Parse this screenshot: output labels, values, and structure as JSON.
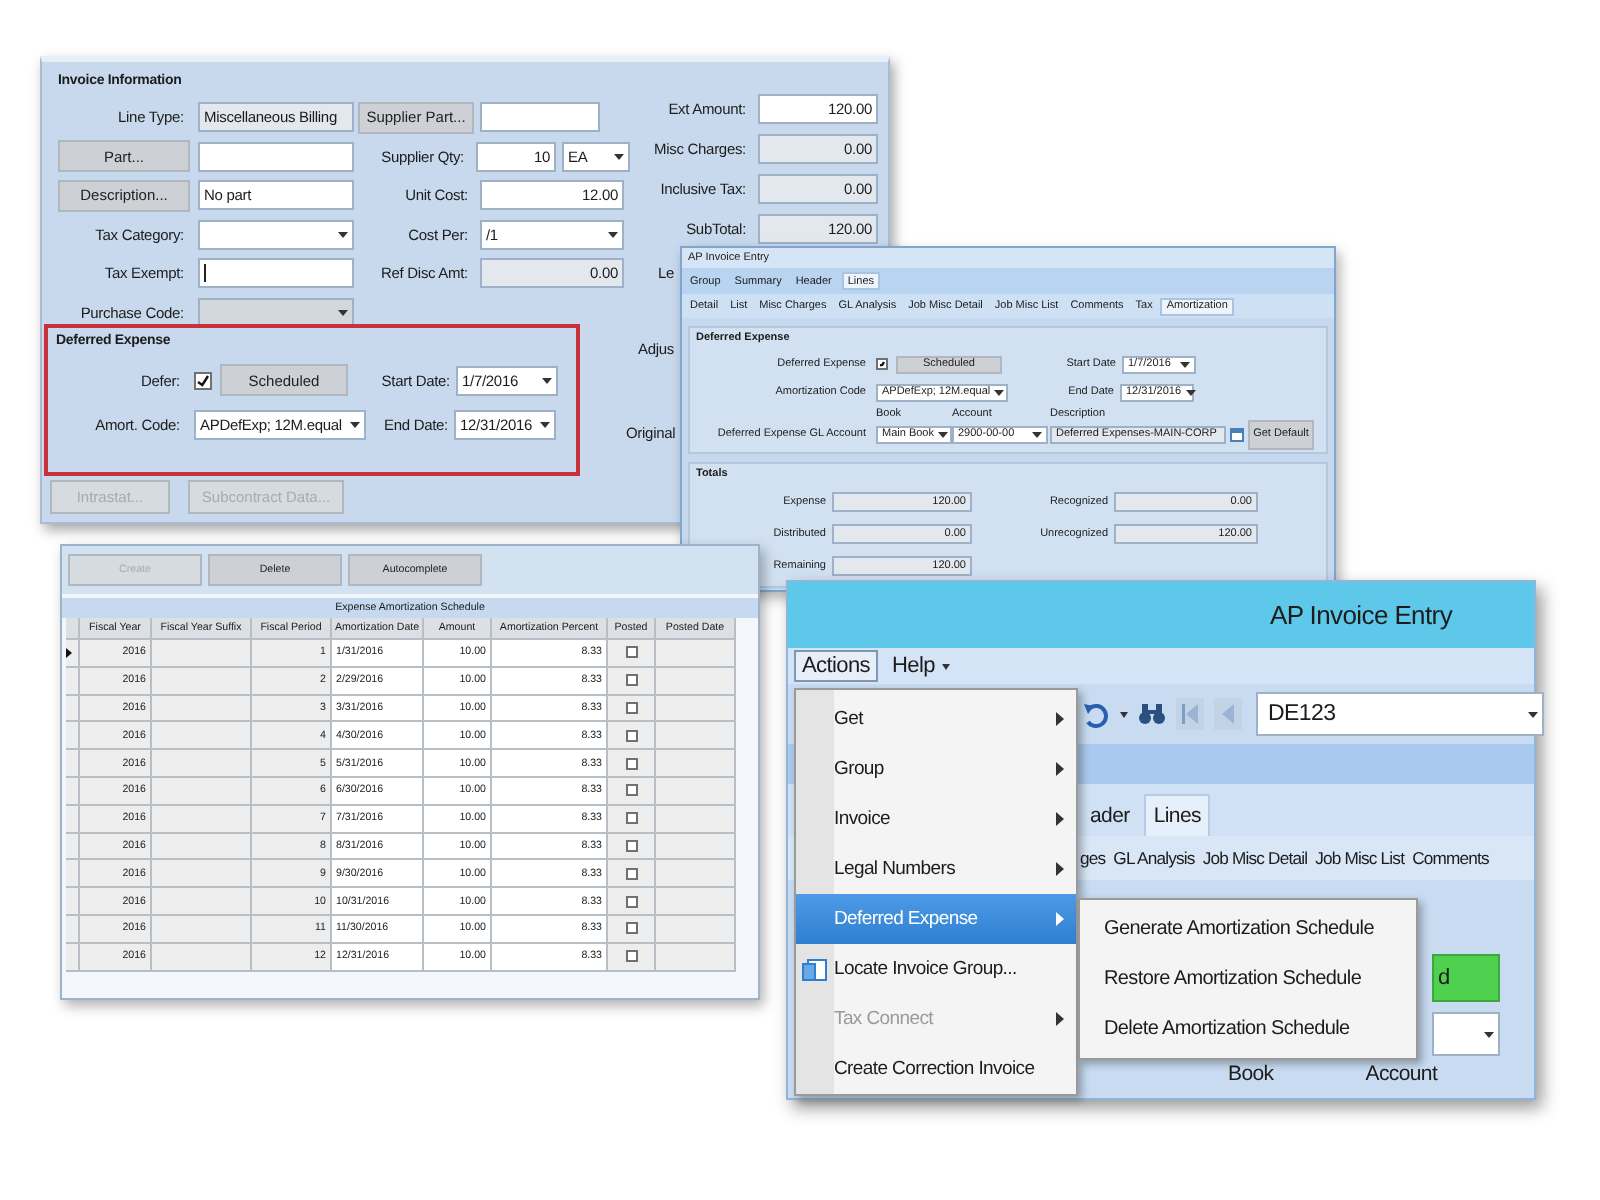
{
  "invoice_panel": {
    "title": "Invoice Information",
    "left_rows": [
      {
        "kind": "readonly",
        "label": "Line Type:",
        "value": "Miscellaneous Billing"
      },
      {
        "kind": "button",
        "button": "Part..."
      },
      {
        "kind": "button",
        "button": "Description...",
        "value": "No part"
      },
      {
        "kind": "combo",
        "label": "Tax Category:",
        "disabled": false
      },
      {
        "kind": "text",
        "label": "Tax Exempt:"
      },
      {
        "kind": "combo",
        "label": "Purchase Code:",
        "disabled": true
      }
    ],
    "middle_rows": [
      {
        "kind": "button",
        "button": "Supplier Part..."
      },
      {
        "kind": "qty",
        "label": "Supplier Qty:",
        "value": "10",
        "unit": "EA"
      },
      {
        "kind": "text",
        "label": "Unit Cost:",
        "value": "12.00"
      },
      {
        "kind": "combo",
        "label": "Cost Per:",
        "value": "/1",
        "disabled": false
      },
      {
        "kind": "readonly",
        "label": "Ref Disc Amt:",
        "value": "0.00"
      }
    ],
    "right_rows": [
      {
        "kind": "text",
        "label": "Ext Amount:",
        "value": "120.00"
      },
      {
        "kind": "readonly",
        "label": "Misc Charges:",
        "value": "0.00"
      },
      {
        "kind": "readonly",
        "label": "Inclusive Tax:",
        "value": "0.00"
      },
      {
        "kind": "readonly",
        "label": "SubTotal:",
        "value": "120.00"
      },
      {
        "kind": "covered",
        "label": "Le"
      },
      {
        "kind": "covered",
        "label": "Adjus"
      },
      {
        "kind": "covered",
        "label": "Original"
      }
    ],
    "deferred_expense": {
      "title": "Deferred Expense",
      "defer_label": "Defer:",
      "defer_checked": true,
      "schedule_button": "Scheduled",
      "amort_code_label": "Amort. Code:",
      "amort_code": "APDefExp; 12M.equal",
      "start_date_label": "Start Date:",
      "start_date": "1/7/2016",
      "end_date_label": "End Date:",
      "end_date": "12/31/2016"
    },
    "buttons": [
      {
        "label": "Intrastat...",
        "disabled": true
      },
      {
        "label": "Subcontract Data...",
        "disabled": true
      }
    ]
  },
  "mini_window": {
    "title": "AP Invoice Entry",
    "tabs": [
      {
        "label": "Group",
        "selected": false
      },
      {
        "label": "Summary",
        "selected": false
      },
      {
        "label": "Header",
        "selected": false
      },
      {
        "label": "Lines",
        "selected": true
      }
    ],
    "subtabs": [
      {
        "label": "Detail",
        "selected": false
      },
      {
        "label": "List",
        "selected": false
      },
      {
        "label": "Misc Charges",
        "selected": false
      },
      {
        "label": "GL Analysis",
        "selected": false
      },
      {
        "label": "Job Misc Detail",
        "selected": false
      },
      {
        "label": "Job Misc List",
        "selected": false
      },
      {
        "label": "Comments",
        "selected": false
      },
      {
        "label": "Tax",
        "selected": false
      },
      {
        "label": "Amortization",
        "selected": true
      }
    ],
    "deferred_expense": {
      "title": "Deferred Expense",
      "checkbox_label": "Deferred Expense",
      "checked": true,
      "schedule_button": "Scheduled",
      "amort_code_label": "Amortization Code",
      "amort_code": "APDefExp; 12M.equal",
      "start_date_label": "Start Date",
      "start_date": "1/7/2016",
      "end_date_label": "End Date",
      "end_date": "12/31/2016",
      "gl_account_label": "Deferred Expense GL Account",
      "book_label": "Book",
      "book": "Main Book",
      "account_label": "Account",
      "account": "2900-00-00",
      "description_label": "Description",
      "description": "Deferred Expenses-MAIN-CORP",
      "default_button": "Get Default"
    },
    "totals": {
      "title": "Totals",
      "left": [
        {
          "label": "Expense",
          "value": "120.00"
        },
        {
          "label": "Distributed",
          "value": "0.00"
        },
        {
          "label": "Remaining",
          "value": "120.00"
        }
      ],
      "right": [
        {
          "label": "Recognized",
          "value": "0.00"
        },
        {
          "label": "Unrecognized",
          "value": "120.00"
        }
      ]
    }
  },
  "schedule_panel": {
    "buttons": [
      {
        "label": "Create",
        "disabled": true
      },
      {
        "label": "Delete",
        "disabled": false
      },
      {
        "label": "Autocomplete",
        "disabled": false
      }
    ],
    "grid_title": "Expense Amortization Schedule",
    "columns": [
      "Fiscal Year",
      "Fiscal Year Suffix",
      "Fiscal Period",
      "Amortization Date",
      "Amount",
      "Amortization Percent",
      "Posted",
      "Posted Date"
    ],
    "rows": [
      {
        "selected": true,
        "fiscal_year": "2016",
        "fiscal_period": "1",
        "amortization_date": "1/31/2016",
        "amount": "10.00",
        "amortization_percent": "8.33",
        "posted": false
      },
      {
        "selected": false,
        "fiscal_year": "2016",
        "fiscal_period": "2",
        "amortization_date": "2/29/2016",
        "amount": "10.00",
        "amortization_percent": "8.33",
        "posted": false
      },
      {
        "selected": false,
        "fiscal_year": "2016",
        "fiscal_period": "3",
        "amortization_date": "3/31/2016",
        "amount": "10.00",
        "amortization_percent": "8.33",
        "posted": false
      },
      {
        "selected": false,
        "fiscal_year": "2016",
        "fiscal_period": "4",
        "amortization_date": "4/30/2016",
        "amount": "10.00",
        "amortization_percent": "8.33",
        "posted": false
      },
      {
        "selected": false,
        "fiscal_year": "2016",
        "fiscal_period": "5",
        "amortization_date": "5/31/2016",
        "amount": "10.00",
        "amortization_percent": "8.33",
        "posted": false
      },
      {
        "selected": false,
        "fiscal_year": "2016",
        "fiscal_period": "6",
        "amortization_date": "6/30/2016",
        "amount": "10.00",
        "amortization_percent": "8.33",
        "posted": false
      },
      {
        "selected": false,
        "fiscal_year": "2016",
        "fiscal_period": "7",
        "amortization_date": "7/31/2016",
        "amount": "10.00",
        "amortization_percent": "8.33",
        "posted": false
      },
      {
        "selected": false,
        "fiscal_year": "2016",
        "fiscal_period": "8",
        "amortization_date": "8/31/2016",
        "amount": "10.00",
        "amortization_percent": "8.33",
        "posted": false
      },
      {
        "selected": false,
        "fiscal_year": "2016",
        "fiscal_period": "9",
        "amortization_date": "9/30/2016",
        "amount": "10.00",
        "amortization_percent": "8.33",
        "posted": false
      },
      {
        "selected": false,
        "fiscal_year": "2016",
        "fiscal_period": "10",
        "amortization_date": "10/31/2016",
        "amount": "10.00",
        "amortization_percent": "8.33",
        "posted": false
      },
      {
        "selected": false,
        "fiscal_year": "2016",
        "fiscal_period": "11",
        "amortization_date": "11/30/2016",
        "amount": "10.00",
        "amortization_percent": "8.33",
        "posted": false
      },
      {
        "selected": false,
        "fiscal_year": "2016",
        "fiscal_period": "12",
        "amortization_date": "12/31/2016",
        "amount": "10.00",
        "amortization_percent": "8.33",
        "posted": false
      }
    ]
  },
  "main_window": {
    "title": "AP Invoice Entry",
    "menus": [
      {
        "label": "Actions",
        "selected": true
      },
      {
        "label": "Help",
        "selected": false
      }
    ],
    "record": "DE123",
    "tabs": [
      {
        "label": "ader",
        "selected": false
      },
      {
        "label": "Lines",
        "selected": true
      }
    ],
    "subtabs": [
      "ges",
      "GL Analysis",
      "Job Misc Detail",
      "Job Misc List",
      "Comments"
    ],
    "scheduled_fragment": "d",
    "column_labels": [
      "Book",
      "Account"
    ],
    "menu": [
      {
        "label": "Get",
        "kind": "submenu",
        "selected": false,
        "disabled": false
      },
      {
        "label": "Group",
        "kind": "submenu",
        "selected": false,
        "disabled": false
      },
      {
        "label": "Invoice",
        "kind": "submenu",
        "selected": false,
        "disabled": false
      },
      {
        "label": "Legal Numbers",
        "kind": "submenu",
        "selected": false,
        "disabled": false
      },
      {
        "label": "Deferred Expense",
        "kind": "submenu",
        "selected": true,
        "disabled": false
      },
      {
        "label": "Locate Invoice Group...",
        "kind": "icon",
        "selected": false,
        "disabled": false
      },
      {
        "label": "Tax Connect",
        "kind": "submenu",
        "selected": false,
        "disabled": true
      },
      {
        "label": "Create Correction Invoice",
        "kind": "plain",
        "selected": false,
        "disabled": false
      }
    ],
    "submenu": [
      "Generate Amortization Schedule",
      "Restore Amortization Schedule",
      "Delete Amortization Schedule"
    ]
  }
}
